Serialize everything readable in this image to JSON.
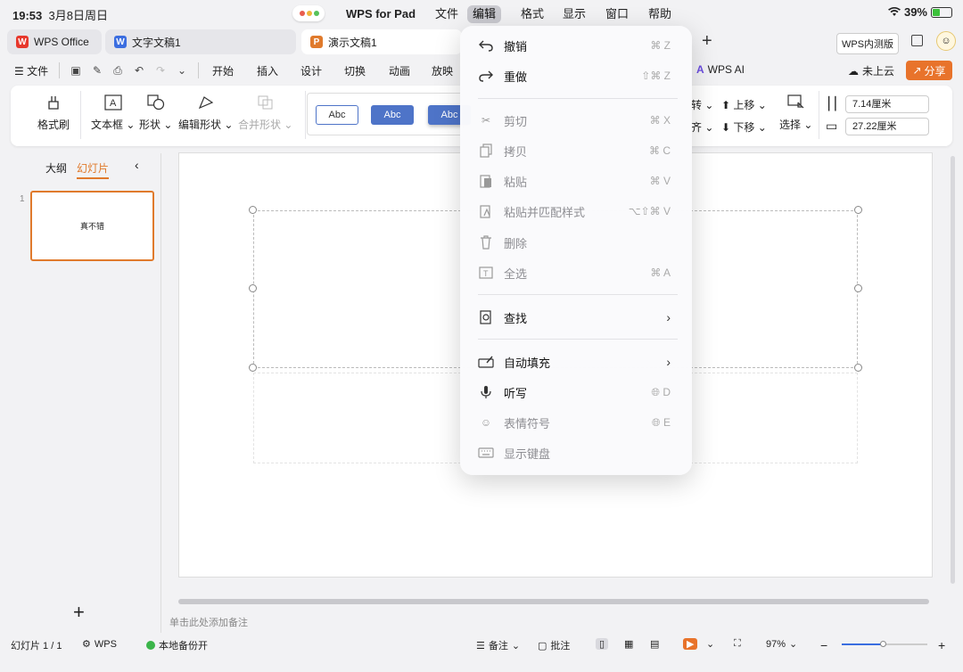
{
  "status": {
    "time": "19:53",
    "date": "3月8日周日",
    "battery": "39%"
  },
  "menubar": {
    "app": "WPS for Pad",
    "items": [
      "文件",
      "编辑",
      "格式",
      "显示",
      "窗口",
      "帮助"
    ]
  },
  "tabs": [
    {
      "label": "WPS Office",
      "logo": "W"
    },
    {
      "label": "文字文稿1",
      "logo": "W"
    },
    {
      "label": "演示文稿1",
      "logo": "P"
    }
  ],
  "tabbar_right": {
    "beta": "WPS内测版"
  },
  "menurow": {
    "file": "文件",
    "items": [
      "开始",
      "插入",
      "设计",
      "切换",
      "动画",
      "放映"
    ],
    "wps_ai": "WPS AI",
    "cloud": "未上云",
    "share": "分享"
  },
  "ribbon": {
    "format_painter": "格式刷",
    "textbox": "文本框",
    "shape": "形状",
    "edit_shape": "编辑形状",
    "merge_shape": "合并形状",
    "styles": [
      "Abc",
      "Abc",
      "Abc"
    ],
    "rotate": "转",
    "align": "齐",
    "move_up": "上移",
    "move_down": "下移",
    "select": "选择",
    "height": "7.14厘米",
    "width": "27.22厘米"
  },
  "leftpane": {
    "outline": "大纲",
    "slides": "幻灯片",
    "thumb_number": "1",
    "thumb_text": "真不错",
    "add": "+"
  },
  "notes_placeholder": "单击此处添加备注",
  "bottombar": {
    "slide_count": "幻灯片 1 / 1",
    "wps": "WPS",
    "backup": "本地备份开",
    "notes": "备注",
    "comments": "批注",
    "zoom": "97%"
  },
  "edit_menu": {
    "items": [
      {
        "label": "撤销",
        "shortcut": "⌘ Z",
        "icon": "undo-icon",
        "disabled": false
      },
      {
        "label": "重做",
        "shortcut": "⇧⌘ Z",
        "icon": "redo-icon",
        "disabled": false
      },
      {
        "label": "剪切",
        "shortcut": "⌘ X",
        "icon": "scissors-icon",
        "disabled": true
      },
      {
        "label": "拷贝",
        "shortcut": "⌘ C",
        "icon": "copy-icon",
        "disabled": true
      },
      {
        "label": "粘贴",
        "shortcut": "⌘ V",
        "icon": "paste-icon",
        "disabled": true
      },
      {
        "label": "粘贴并匹配样式",
        "shortcut": "⌥⇧⌘ V",
        "icon": "paste-match-icon",
        "disabled": true
      },
      {
        "label": "删除",
        "shortcut": "",
        "icon": "trash-icon",
        "disabled": true
      },
      {
        "label": "全选",
        "shortcut": "⌘ A",
        "icon": "select-all-icon",
        "disabled": true
      },
      {
        "label": "查找",
        "shortcut": "",
        "icon": "find-icon",
        "disabled": false
      },
      {
        "label": "自动填充",
        "shortcut": "",
        "icon": "autofill-icon",
        "disabled": false
      },
      {
        "label": "听写",
        "shortcut": "D",
        "icon": "microphone-icon",
        "disabled": false
      },
      {
        "label": "表情符号",
        "shortcut": "E",
        "icon": "emoji-icon",
        "disabled": true
      },
      {
        "label": "显示键盘",
        "shortcut": "",
        "icon": "keyboard-icon",
        "disabled": true
      }
    ]
  },
  "colors": {
    "accent": "#e07a2c",
    "style_blue": "#4e74c8",
    "share": "#e8732b"
  }
}
